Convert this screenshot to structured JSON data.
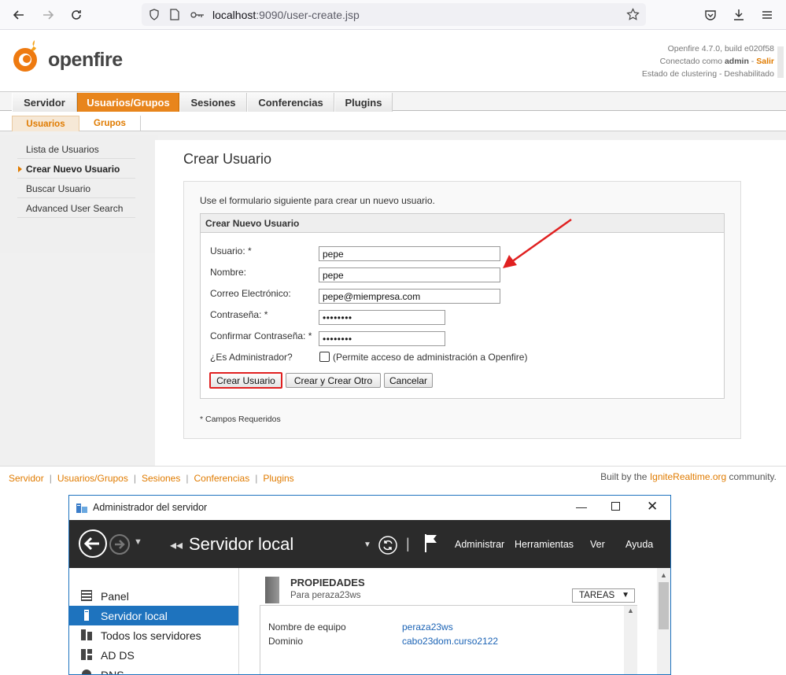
{
  "browser": {
    "url_host": "localhost",
    "url_rest": ":9090/user-create.jsp"
  },
  "header": {
    "logo_text": "openfire",
    "version": "Openfire 4.7.0, build e020f58",
    "connected_prefix": "Conectado como ",
    "connected_user": "admin",
    "separator": " - ",
    "logout": "Salir",
    "clustering": "Estado de clustering - Deshabilitado"
  },
  "main_tabs": [
    {
      "label": "Servidor"
    },
    {
      "label": "Usuarios/Grupos"
    },
    {
      "label": "Sesiones"
    },
    {
      "label": "Conferencias"
    },
    {
      "label": "Plugins"
    }
  ],
  "sub_tabs": [
    {
      "label": "Usuarios"
    },
    {
      "label": "Grupos"
    }
  ],
  "sidebar": {
    "items": [
      {
        "label": "Lista de Usuarios"
      },
      {
        "label": "Crear Nuevo Usuario"
      },
      {
        "label": "Buscar Usuario"
      },
      {
        "label": "Advanced User Search"
      }
    ]
  },
  "page": {
    "title": "Crear Usuario",
    "intro": "Use el formulario siguiente para crear un nuevo usuario.",
    "form_title": "Crear Nuevo Usuario",
    "fields": {
      "username_label": "Usuario: *",
      "username_value": "pepe",
      "name_label": "Nombre:",
      "name_value": "pepe",
      "email_label": "Correo Electrónico:",
      "email_value": "pepe@miempresa.com",
      "password_label": "Contraseña: *",
      "password_value": "••••••••",
      "confirm_label": "Confirmar Contraseña: *",
      "confirm_value": "••••••••",
      "admin_label": "¿Es Administrador?",
      "admin_hint": "(Permite acceso de administración a Openfire)"
    },
    "buttons": {
      "create": "Crear Usuario",
      "create_another": "Crear y Crear Otro",
      "cancel": "Cancelar"
    },
    "required_note": "* Campos Requeridos"
  },
  "footer": {
    "links": [
      "Servidor",
      "Usuarios/Grupos",
      "Sesiones",
      "Conferencias",
      "Plugins"
    ],
    "built_prefix": "Built by the ",
    "built_link": "IgniteRealtime.org",
    "built_suffix": " community."
  },
  "server_manager": {
    "window_title": "Administrador del servidor",
    "heading": "Servidor local",
    "menu": [
      "Administrar",
      "Herramientas",
      "Ver",
      "Ayuda"
    ],
    "nav": [
      {
        "label": "Panel"
      },
      {
        "label": "Servidor local"
      },
      {
        "label": "Todos los servidores"
      },
      {
        "label": "AD DS"
      },
      {
        "label": "DNS"
      }
    ],
    "properties_title": "PROPIEDADES",
    "properties_sub": "Para peraza23ws",
    "tasks_label": "TAREAS",
    "props": [
      {
        "key": "Nombre de equipo",
        "value": "peraza23ws"
      },
      {
        "key": "Dominio",
        "value": "cabo23dom.curso2122"
      }
    ]
  },
  "colors": {
    "accent": "#e07b00",
    "highlight": "#e02020",
    "sm_blue": "#1e73be"
  }
}
